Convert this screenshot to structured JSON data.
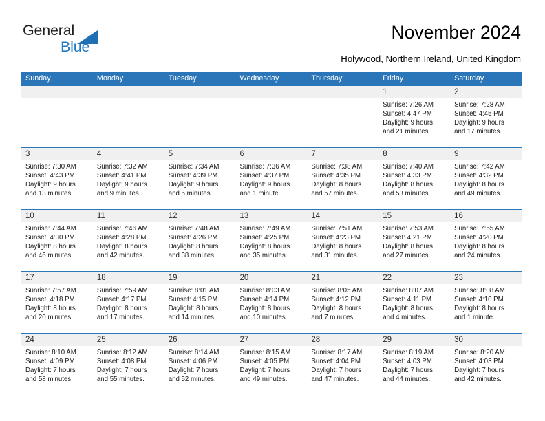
{
  "brand": {
    "name_primary": "General",
    "name_secondary": "Blue",
    "triangle_color": "#1f6fb5",
    "text_color": "#231f20",
    "secondary_color": "#2179c0"
  },
  "header": {
    "title": "November 2024",
    "subtitle": "Holywood, Northern Ireland, United Kingdom"
  },
  "theme": {
    "header_bg": "#2b76b9",
    "header_text": "#ffffff",
    "datebar_bg": "#f0f0f0",
    "cell_bg": "#ffffff",
    "separator": "#2b76b9"
  },
  "weekdays": [
    "Sunday",
    "Monday",
    "Tuesday",
    "Wednesday",
    "Thursday",
    "Friday",
    "Saturday"
  ],
  "weeks": [
    {
      "days": [
        {
          "num": "",
          "lines": []
        },
        {
          "num": "",
          "lines": []
        },
        {
          "num": "",
          "lines": []
        },
        {
          "num": "",
          "lines": []
        },
        {
          "num": "",
          "lines": []
        },
        {
          "num": "1",
          "lines": [
            "Sunrise: 7:26 AM",
            "Sunset: 4:47 PM",
            "Daylight: 9 hours",
            "and 21 minutes."
          ]
        },
        {
          "num": "2",
          "lines": [
            "Sunrise: 7:28 AM",
            "Sunset: 4:45 PM",
            "Daylight: 9 hours",
            "and 17 minutes."
          ]
        }
      ]
    },
    {
      "days": [
        {
          "num": "3",
          "lines": [
            "Sunrise: 7:30 AM",
            "Sunset: 4:43 PM",
            "Daylight: 9 hours",
            "and 13 minutes."
          ]
        },
        {
          "num": "4",
          "lines": [
            "Sunrise: 7:32 AM",
            "Sunset: 4:41 PM",
            "Daylight: 9 hours",
            "and 9 minutes."
          ]
        },
        {
          "num": "5",
          "lines": [
            "Sunrise: 7:34 AM",
            "Sunset: 4:39 PM",
            "Daylight: 9 hours",
            "and 5 minutes."
          ]
        },
        {
          "num": "6",
          "lines": [
            "Sunrise: 7:36 AM",
            "Sunset: 4:37 PM",
            "Daylight: 9 hours",
            "and 1 minute."
          ]
        },
        {
          "num": "7",
          "lines": [
            "Sunrise: 7:38 AM",
            "Sunset: 4:35 PM",
            "Daylight: 8 hours",
            "and 57 minutes."
          ]
        },
        {
          "num": "8",
          "lines": [
            "Sunrise: 7:40 AM",
            "Sunset: 4:33 PM",
            "Daylight: 8 hours",
            "and 53 minutes."
          ]
        },
        {
          "num": "9",
          "lines": [
            "Sunrise: 7:42 AM",
            "Sunset: 4:32 PM",
            "Daylight: 8 hours",
            "and 49 minutes."
          ]
        }
      ]
    },
    {
      "days": [
        {
          "num": "10",
          "lines": [
            "Sunrise: 7:44 AM",
            "Sunset: 4:30 PM",
            "Daylight: 8 hours",
            "and 46 minutes."
          ]
        },
        {
          "num": "11",
          "lines": [
            "Sunrise: 7:46 AM",
            "Sunset: 4:28 PM",
            "Daylight: 8 hours",
            "and 42 minutes."
          ]
        },
        {
          "num": "12",
          "lines": [
            "Sunrise: 7:48 AM",
            "Sunset: 4:26 PM",
            "Daylight: 8 hours",
            "and 38 minutes."
          ]
        },
        {
          "num": "13",
          "lines": [
            "Sunrise: 7:49 AM",
            "Sunset: 4:25 PM",
            "Daylight: 8 hours",
            "and 35 minutes."
          ]
        },
        {
          "num": "14",
          "lines": [
            "Sunrise: 7:51 AM",
            "Sunset: 4:23 PM",
            "Daylight: 8 hours",
            "and 31 minutes."
          ]
        },
        {
          "num": "15",
          "lines": [
            "Sunrise: 7:53 AM",
            "Sunset: 4:21 PM",
            "Daylight: 8 hours",
            "and 27 minutes."
          ]
        },
        {
          "num": "16",
          "lines": [
            "Sunrise: 7:55 AM",
            "Sunset: 4:20 PM",
            "Daylight: 8 hours",
            "and 24 minutes."
          ]
        }
      ]
    },
    {
      "days": [
        {
          "num": "17",
          "lines": [
            "Sunrise: 7:57 AM",
            "Sunset: 4:18 PM",
            "Daylight: 8 hours",
            "and 20 minutes."
          ]
        },
        {
          "num": "18",
          "lines": [
            "Sunrise: 7:59 AM",
            "Sunset: 4:17 PM",
            "Daylight: 8 hours",
            "and 17 minutes."
          ]
        },
        {
          "num": "19",
          "lines": [
            "Sunrise: 8:01 AM",
            "Sunset: 4:15 PM",
            "Daylight: 8 hours",
            "and 14 minutes."
          ]
        },
        {
          "num": "20",
          "lines": [
            "Sunrise: 8:03 AM",
            "Sunset: 4:14 PM",
            "Daylight: 8 hours",
            "and 10 minutes."
          ]
        },
        {
          "num": "21",
          "lines": [
            "Sunrise: 8:05 AM",
            "Sunset: 4:12 PM",
            "Daylight: 8 hours",
            "and 7 minutes."
          ]
        },
        {
          "num": "22",
          "lines": [
            "Sunrise: 8:07 AM",
            "Sunset: 4:11 PM",
            "Daylight: 8 hours",
            "and 4 minutes."
          ]
        },
        {
          "num": "23",
          "lines": [
            "Sunrise: 8:08 AM",
            "Sunset: 4:10 PM",
            "Daylight: 8 hours",
            "and 1 minute."
          ]
        }
      ]
    },
    {
      "days": [
        {
          "num": "24",
          "lines": [
            "Sunrise: 8:10 AM",
            "Sunset: 4:09 PM",
            "Daylight: 7 hours",
            "and 58 minutes."
          ]
        },
        {
          "num": "25",
          "lines": [
            "Sunrise: 8:12 AM",
            "Sunset: 4:08 PM",
            "Daylight: 7 hours",
            "and 55 minutes."
          ]
        },
        {
          "num": "26",
          "lines": [
            "Sunrise: 8:14 AM",
            "Sunset: 4:06 PM",
            "Daylight: 7 hours",
            "and 52 minutes."
          ]
        },
        {
          "num": "27",
          "lines": [
            "Sunrise: 8:15 AM",
            "Sunset: 4:05 PM",
            "Daylight: 7 hours",
            "and 49 minutes."
          ]
        },
        {
          "num": "28",
          "lines": [
            "Sunrise: 8:17 AM",
            "Sunset: 4:04 PM",
            "Daylight: 7 hours",
            "and 47 minutes."
          ]
        },
        {
          "num": "29",
          "lines": [
            "Sunrise: 8:19 AM",
            "Sunset: 4:03 PM",
            "Daylight: 7 hours",
            "and 44 minutes."
          ]
        },
        {
          "num": "30",
          "lines": [
            "Sunrise: 8:20 AM",
            "Sunset: 4:03 PM",
            "Daylight: 7 hours",
            "and 42 minutes."
          ]
        }
      ]
    }
  ]
}
